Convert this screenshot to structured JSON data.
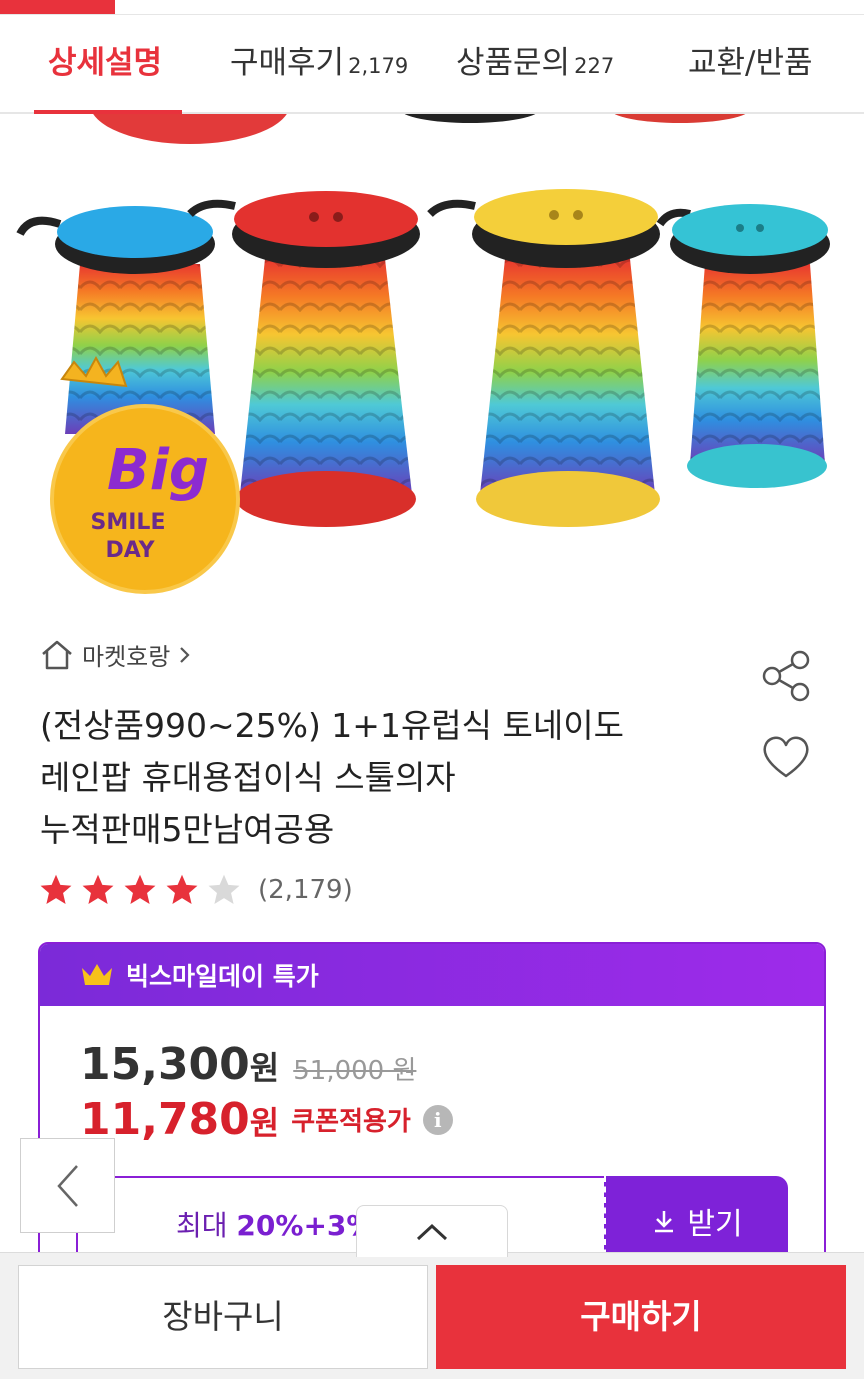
{
  "tabs": [
    {
      "label": "상세설명",
      "count": "",
      "active": true
    },
    {
      "label": "구매후기",
      "count": "2,179",
      "active": false
    },
    {
      "label": "상품문의",
      "count": "227",
      "active": false
    },
    {
      "label": "교환/반품",
      "count": "",
      "active": false
    }
  ],
  "hero": {
    "badge_big": "Big",
    "badge_line1": "SMILE",
    "badge_line2": "DAY"
  },
  "seller": {
    "name": "마켓호랑",
    "icon": "home-icon"
  },
  "product": {
    "title_line1": "(전상품990~25%) 1+1유럽식 토네이도",
    "title_line2": "레인팝 휴대용접이식 스툴의자",
    "title_line3": "누적판매5만남여공용"
  },
  "rating": {
    "stars": 4,
    "max": 5,
    "count_text": "(2,179)"
  },
  "promo": {
    "header_label": "빅스마일데이 특가",
    "price": "15,300",
    "price_unit": "원",
    "original_price": "51,000 원",
    "coupon_price": "11,780",
    "coupon_unit": "원",
    "coupon_label": "쿠폰적용가",
    "info_icon": "i"
  },
  "coupon": {
    "prefix": "최대 ",
    "rate": "20%+3%",
    "get_label": "받기"
  },
  "bottom": {
    "cart_label": "장바구니",
    "buy_label": "구매하기"
  },
  "colors": {
    "accent": "#e8323c",
    "promo_purple": "#7e22d8",
    "coupon_red": "#d7212c",
    "star": "#e8323c",
    "star_empty": "#d9d9d9"
  }
}
